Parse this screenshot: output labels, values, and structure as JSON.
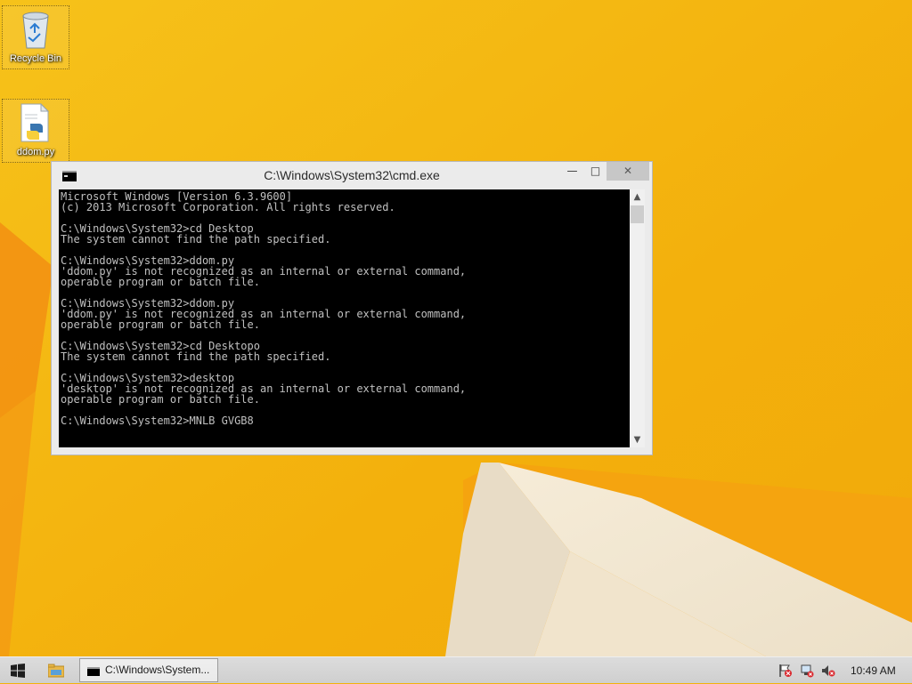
{
  "desktop": {
    "icons": [
      {
        "label": "Recycle Bin",
        "icon": "recycle-bin-icon"
      },
      {
        "label": "ddom.py",
        "icon": "python-file-icon"
      }
    ]
  },
  "cmd": {
    "title": "C:\\Windows\\System32\\cmd.exe",
    "buttons": {
      "minimize": "—",
      "maximize": "□",
      "close": "✕"
    },
    "lines": [
      "Microsoft Windows [Version 6.3.9600]",
      "(c) 2013 Microsoft Corporation. All rights reserved.",
      "",
      "C:\\Windows\\System32>cd Desktop",
      "The system cannot find the path specified.",
      "",
      "C:\\Windows\\System32>ddom.py",
      "'ddom.py' is not recognized as an internal or external command,",
      "operable program or batch file.",
      "",
      "C:\\Windows\\System32>ddom.py",
      "'ddom.py' is not recognized as an internal or external command,",
      "operable program or batch file.",
      "",
      "C:\\Windows\\System32>cd Desktopo",
      "The system cannot find the path specified.",
      "",
      "C:\\Windows\\System32>desktop",
      "'desktop' is not recognized as an internal or external command,",
      "operable program or batch file.",
      "",
      "C:\\Windows\\System32>MNLB GVGB8"
    ],
    "colors": {
      "background": "#000000",
      "text": "#c0c0c0"
    }
  },
  "taskbar": {
    "task_label": "C:\\Windows\\System...",
    "tray_icons": [
      "action-center-flag-icon",
      "network-icon",
      "volume-muted-icon"
    ],
    "clock": "10:49 AM"
  },
  "colors": {
    "wallpaper_accent": "#f4b20d",
    "taskbar": "#d4d4d4"
  }
}
